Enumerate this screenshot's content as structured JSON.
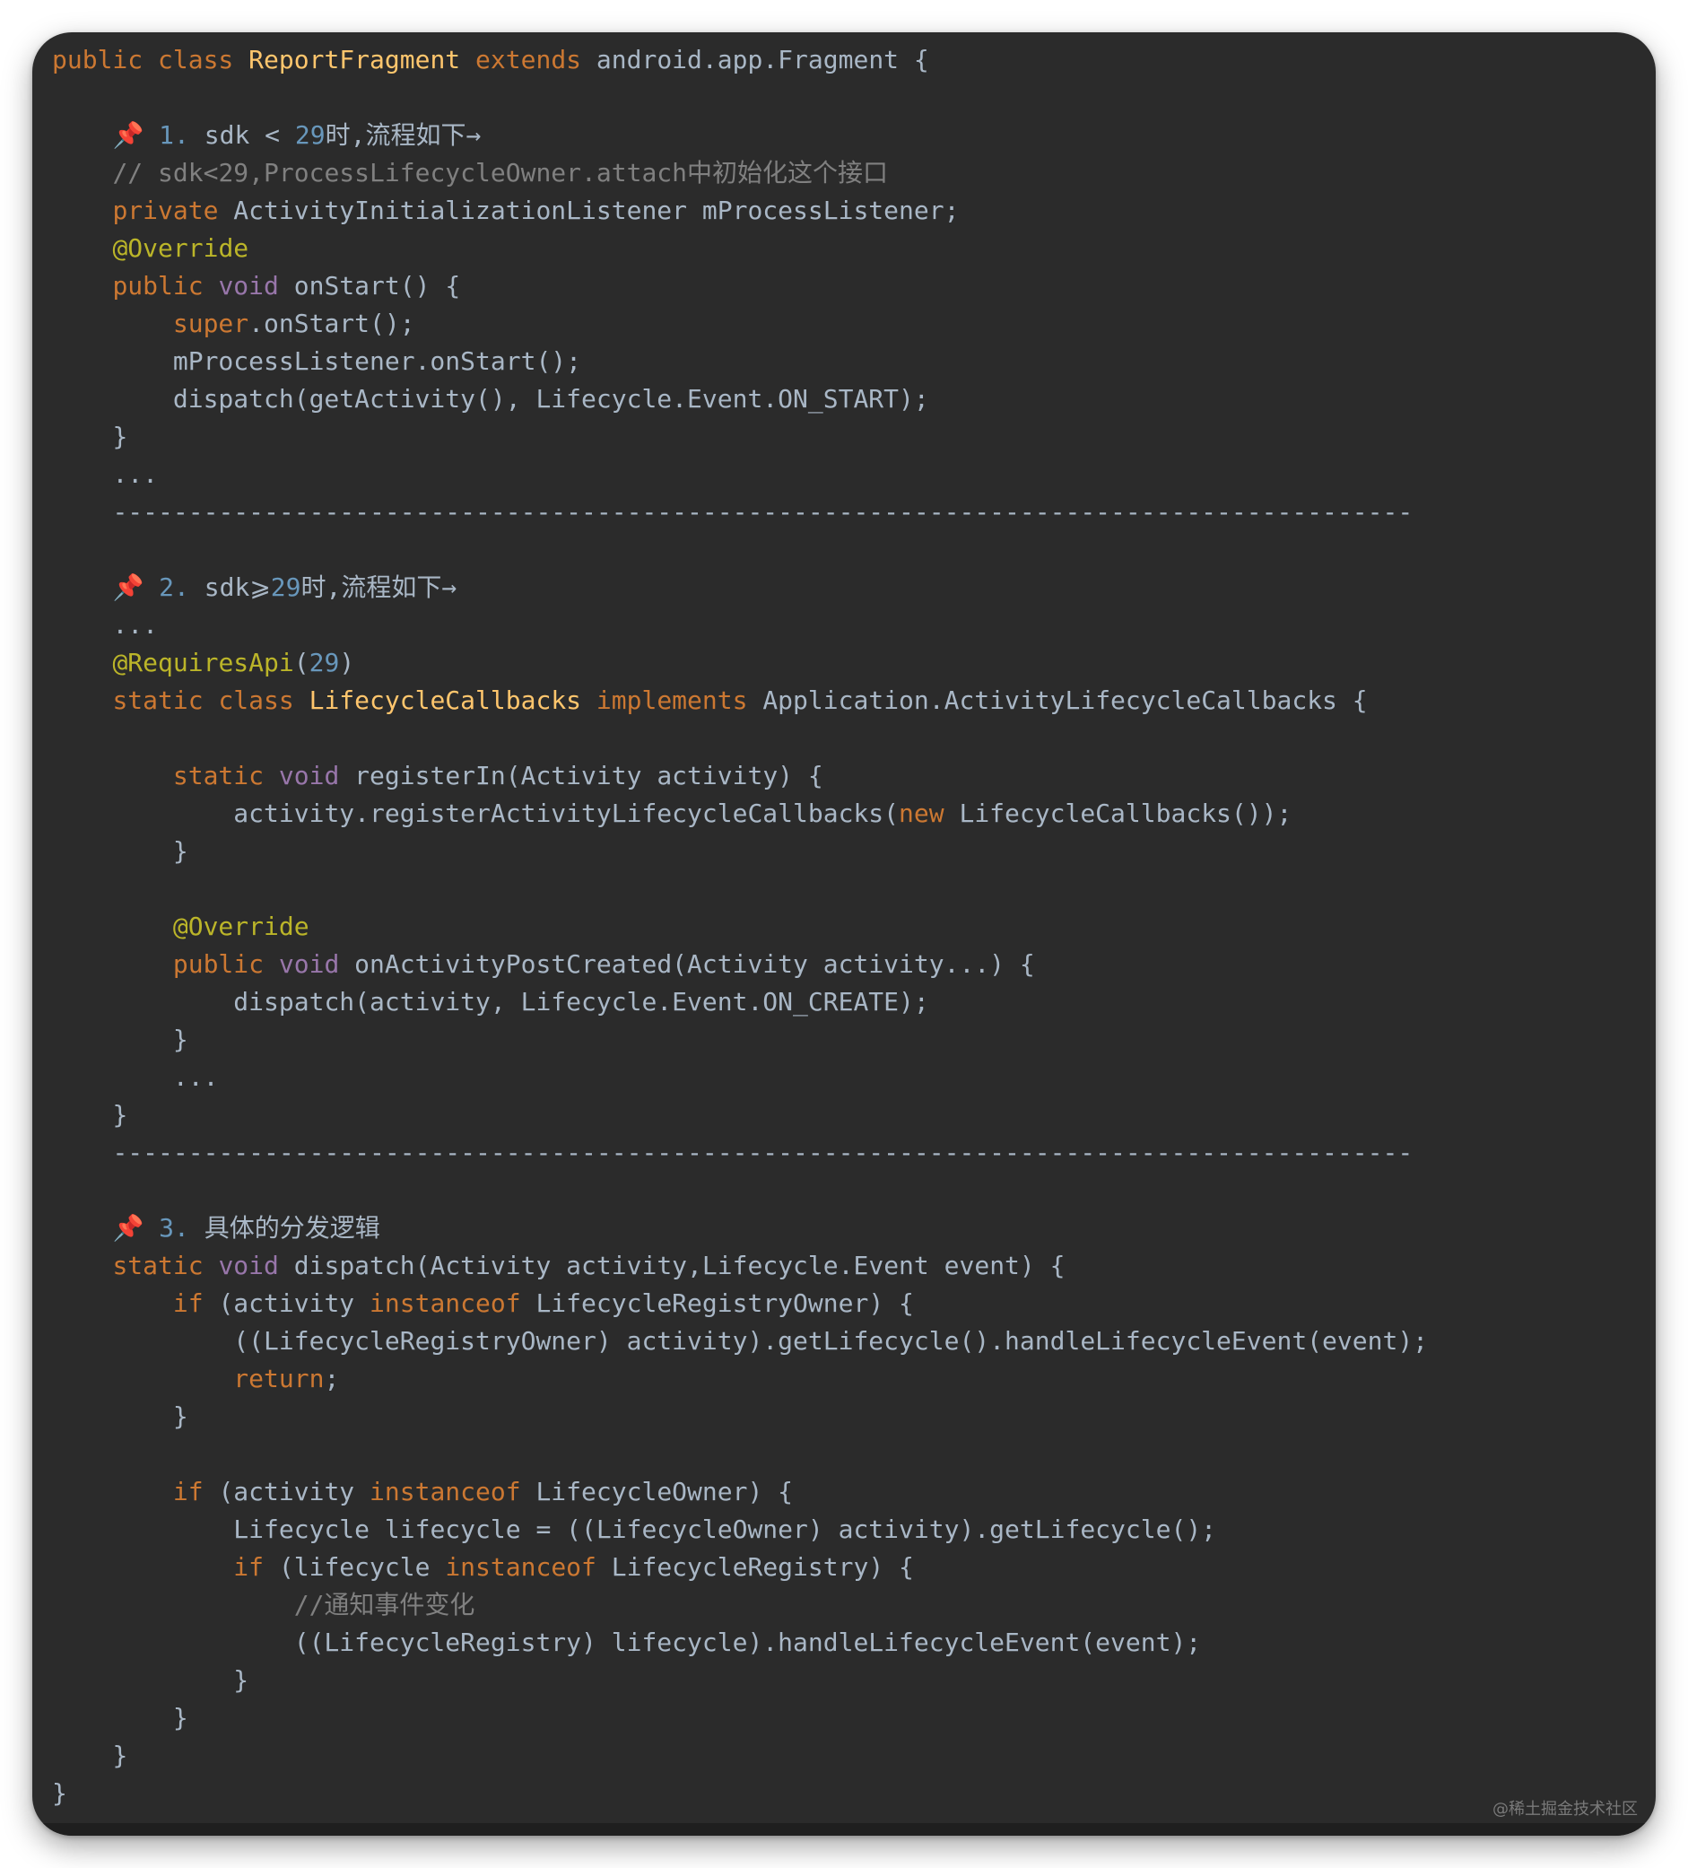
{
  "editor": {
    "theme_colors": {
      "background": "#2b2b2b",
      "keyword": "#cc7832",
      "type_keyword": "#9876aa",
      "class_name": "#ffc66d",
      "annotation": "#bbb529",
      "number": "#6897bb",
      "comment": "#808080",
      "text": "#a9b7c6"
    },
    "pin_icon": "pushpin-icon",
    "lines": [
      {
        "indent": 0,
        "segs": [
          [
            "kw",
            "public class "
          ],
          [
            "cls",
            "ReportFragment"
          ],
          [
            "kw",
            " extends "
          ],
          [
            "",
            "android.app.Fragment {"
          ]
        ]
      },
      {
        "indent": 0,
        "segs": []
      },
      {
        "indent": 1,
        "pin": true,
        "segs": [
          [
            "num",
            "1. "
          ],
          [
            "",
            "sdk < "
          ],
          [
            "num",
            "29"
          ],
          [
            "",
            "时,流程如下→"
          ]
        ]
      },
      {
        "indent": 1,
        "segs": [
          [
            "cmt",
            "// sdk<29,ProcessLifecycleOwner.attach中初始化这个接口"
          ]
        ]
      },
      {
        "indent": 1,
        "segs": [
          [
            "kw",
            "private "
          ],
          [
            "",
            "ActivityInitializationListener mProcessListener;"
          ]
        ]
      },
      {
        "indent": 1,
        "segs": [
          [
            "ann",
            "@Override"
          ]
        ]
      },
      {
        "indent": 1,
        "segs": [
          [
            "kw",
            "public "
          ],
          [
            "kw2",
            "void "
          ],
          [
            "",
            "onStart() {"
          ]
        ]
      },
      {
        "indent": 2,
        "segs": [
          [
            "kw",
            "super"
          ],
          [
            "",
            ".onStart();"
          ]
        ]
      },
      {
        "indent": 2,
        "segs": [
          [
            "",
            "mProcessListener.onStart();"
          ]
        ]
      },
      {
        "indent": 2,
        "segs": [
          [
            "",
            "dispatch(getActivity(), Lifecycle.Event.ON_START);"
          ]
        ]
      },
      {
        "indent": 1,
        "segs": [
          [
            "",
            "}"
          ]
        ]
      },
      {
        "indent": 1,
        "segs": [
          [
            "",
            "..."
          ]
        ]
      },
      {
        "indent": 1,
        "segs": [
          [
            "",
            "--------------------------------------------------------------------------------------"
          ]
        ]
      },
      {
        "indent": 0,
        "segs": []
      },
      {
        "indent": 1,
        "pin": true,
        "segs": [
          [
            "num",
            "2. "
          ],
          [
            "",
            "sdk⩾"
          ],
          [
            "num",
            "29"
          ],
          [
            "",
            "时,流程如下→"
          ]
        ]
      },
      {
        "indent": 1,
        "segs": [
          [
            "",
            "..."
          ]
        ]
      },
      {
        "indent": 1,
        "segs": [
          [
            "ann",
            "@RequiresApi"
          ],
          [
            "",
            "("
          ],
          [
            "num",
            "29"
          ],
          [
            "",
            ")"
          ]
        ]
      },
      {
        "indent": 1,
        "segs": [
          [
            "kw",
            "static class "
          ],
          [
            "cls",
            "LifecycleCallbacks"
          ],
          [
            "kw",
            " implements "
          ],
          [
            "",
            "Application.ActivityLifecycleCallbacks {"
          ]
        ]
      },
      {
        "indent": 0,
        "segs": []
      },
      {
        "indent": 2,
        "segs": [
          [
            "kw",
            "static "
          ],
          [
            "kw2",
            "void "
          ],
          [
            "",
            "registerIn(Activity activity) {"
          ]
        ]
      },
      {
        "indent": 3,
        "segs": [
          [
            "",
            "activity.registerActivityLifecycleCallbacks("
          ],
          [
            "kw",
            "new "
          ],
          [
            "",
            "LifecycleCallbacks());"
          ]
        ]
      },
      {
        "indent": 2,
        "segs": [
          [
            "",
            "}"
          ]
        ]
      },
      {
        "indent": 0,
        "segs": []
      },
      {
        "indent": 2,
        "segs": [
          [
            "ann",
            "@Override"
          ]
        ]
      },
      {
        "indent": 2,
        "segs": [
          [
            "kw",
            "public "
          ],
          [
            "kw2",
            "void "
          ],
          [
            "",
            "onActivityPostCreated(Activity activity...) {"
          ]
        ]
      },
      {
        "indent": 3,
        "segs": [
          [
            "",
            "dispatch(activity, Lifecycle.Event.ON_CREATE);"
          ]
        ]
      },
      {
        "indent": 2,
        "segs": [
          [
            "",
            "}"
          ]
        ]
      },
      {
        "indent": 2,
        "segs": [
          [
            "",
            "..."
          ]
        ]
      },
      {
        "indent": 1,
        "segs": [
          [
            "",
            "}"
          ]
        ]
      },
      {
        "indent": 1,
        "segs": [
          [
            "",
            "--------------------------------------------------------------------------------------"
          ]
        ]
      },
      {
        "indent": 0,
        "segs": []
      },
      {
        "indent": 1,
        "pin": true,
        "segs": [
          [
            "num",
            "3. "
          ],
          [
            "",
            "具体的分发逻辑"
          ]
        ]
      },
      {
        "indent": 1,
        "segs": [
          [
            "kw",
            "static "
          ],
          [
            "kw2",
            "void "
          ],
          [
            "",
            "dispatch(Activity activity,Lifecycle.Event event) {"
          ]
        ]
      },
      {
        "indent": 2,
        "segs": [
          [
            "kw",
            "if "
          ],
          [
            "",
            "(activity "
          ],
          [
            "kw",
            "instanceof "
          ],
          [
            "",
            "LifecycleRegistryOwner) {"
          ]
        ]
      },
      {
        "indent": 3,
        "segs": [
          [
            "",
            "((LifecycleRegistryOwner) activity).getLifecycle().handleLifecycleEvent(event);"
          ]
        ]
      },
      {
        "indent": 3,
        "segs": [
          [
            "kw",
            "return"
          ],
          [
            "",
            ";"
          ]
        ]
      },
      {
        "indent": 2,
        "segs": [
          [
            "",
            "}"
          ]
        ]
      },
      {
        "indent": 0,
        "segs": []
      },
      {
        "indent": 2,
        "segs": [
          [
            "kw",
            "if "
          ],
          [
            "",
            "(activity "
          ],
          [
            "kw",
            "instanceof "
          ],
          [
            "",
            "LifecycleOwner) {"
          ]
        ]
      },
      {
        "indent": 3,
        "segs": [
          [
            "",
            "Lifecycle lifecycle = ((LifecycleOwner) activity).getLifecycle();"
          ]
        ]
      },
      {
        "indent": 3,
        "segs": [
          [
            "kw",
            "if "
          ],
          [
            "",
            "(lifecycle "
          ],
          [
            "kw",
            "instanceof "
          ],
          [
            "",
            "LifecycleRegistry) {"
          ]
        ]
      },
      {
        "indent": 4,
        "segs": [
          [
            "cmt",
            "//通知事件变化"
          ]
        ]
      },
      {
        "indent": 4,
        "segs": [
          [
            "",
            "((LifecycleRegistry) lifecycle).handleLifecycleEvent(event);"
          ]
        ]
      },
      {
        "indent": 3,
        "segs": [
          [
            "",
            "}"
          ]
        ]
      },
      {
        "indent": 2,
        "segs": [
          [
            "",
            "}"
          ]
        ]
      },
      {
        "indent": 1,
        "segs": [
          [
            "",
            "}"
          ]
        ]
      },
      {
        "indent": 0,
        "segs": [
          [
            "",
            "}"
          ]
        ]
      }
    ]
  },
  "watermark": "@稀土掘金技术社区"
}
